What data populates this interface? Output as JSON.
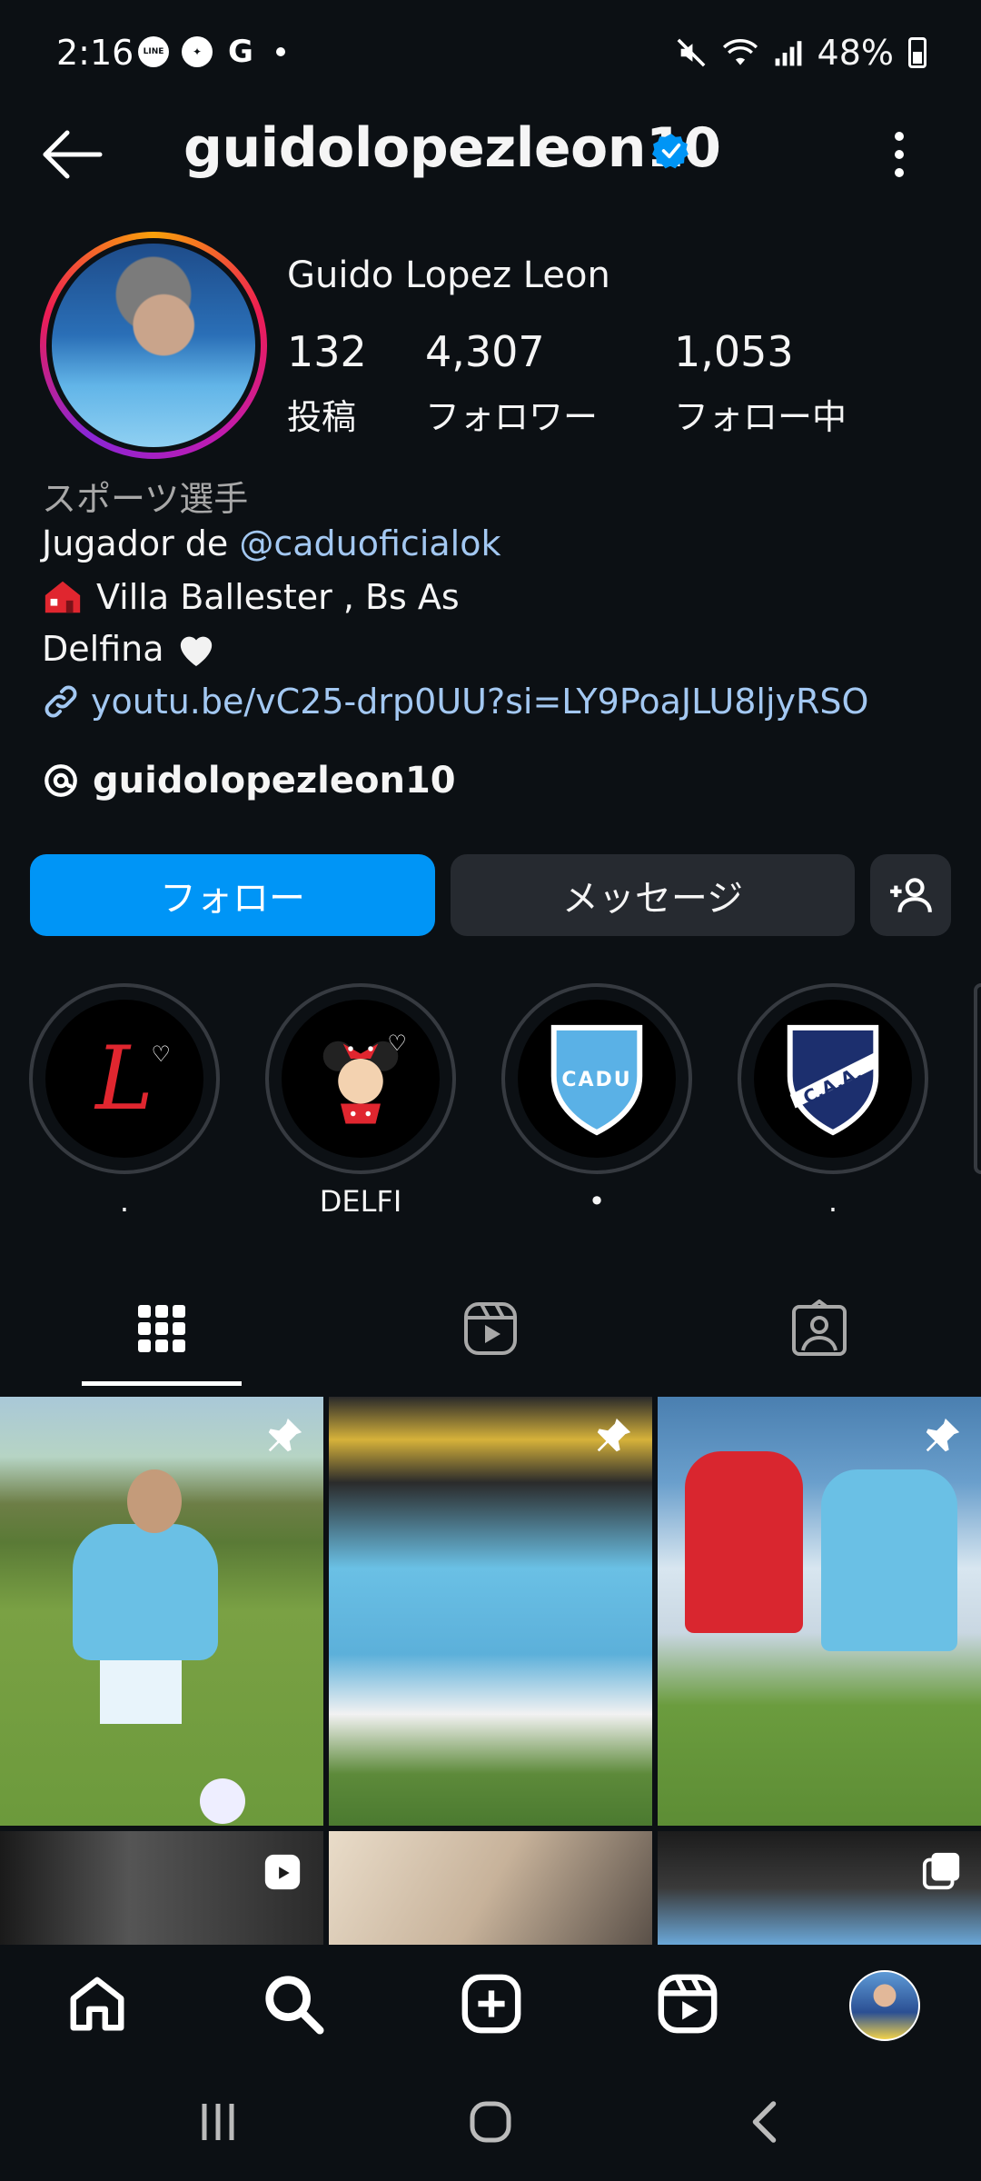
{
  "status_bar": {
    "time": "2:16",
    "app_icons": [
      "LINE",
      "messenger-icon",
      "G"
    ],
    "battery": "48%"
  },
  "header": {
    "username": "guidolopezleon10"
  },
  "profile": {
    "display_name": "Guido Lopez Leon",
    "stats": [
      {
        "value": "132",
        "label": "投稿"
      },
      {
        "value": "4,307",
        "label": "フォロワー"
      },
      {
        "value": "1,053",
        "label": "フォロー中"
      }
    ],
    "category": "スポーツ選手",
    "bio_prefix": "Jugador de ",
    "bio_mention": "@caduoficialok",
    "location": "Villa Ballester , Bs As",
    "bio_line3": "Delfina",
    "link": "youtu.be/vC25-drp0UU?si=LY9PoaJLU8ljyRSO",
    "threads_handle": "guidolopezleon10"
  },
  "actions": {
    "follow": "フォロー",
    "message": "メッセージ"
  },
  "highlights": [
    {
      "label": ".",
      "badge": "L"
    },
    {
      "label": "DELFI",
      "badge": ""
    },
    {
      "label": "•",
      "badge": "CADU"
    },
    {
      "label": ".",
      "badge": "C.A.A."
    }
  ],
  "colors": {
    "background": "#0c1014",
    "accent": "#0095f6",
    "secondary_button": "#262a30",
    "link": "#a3c8f2",
    "muted_text": "#a8a8a8"
  }
}
